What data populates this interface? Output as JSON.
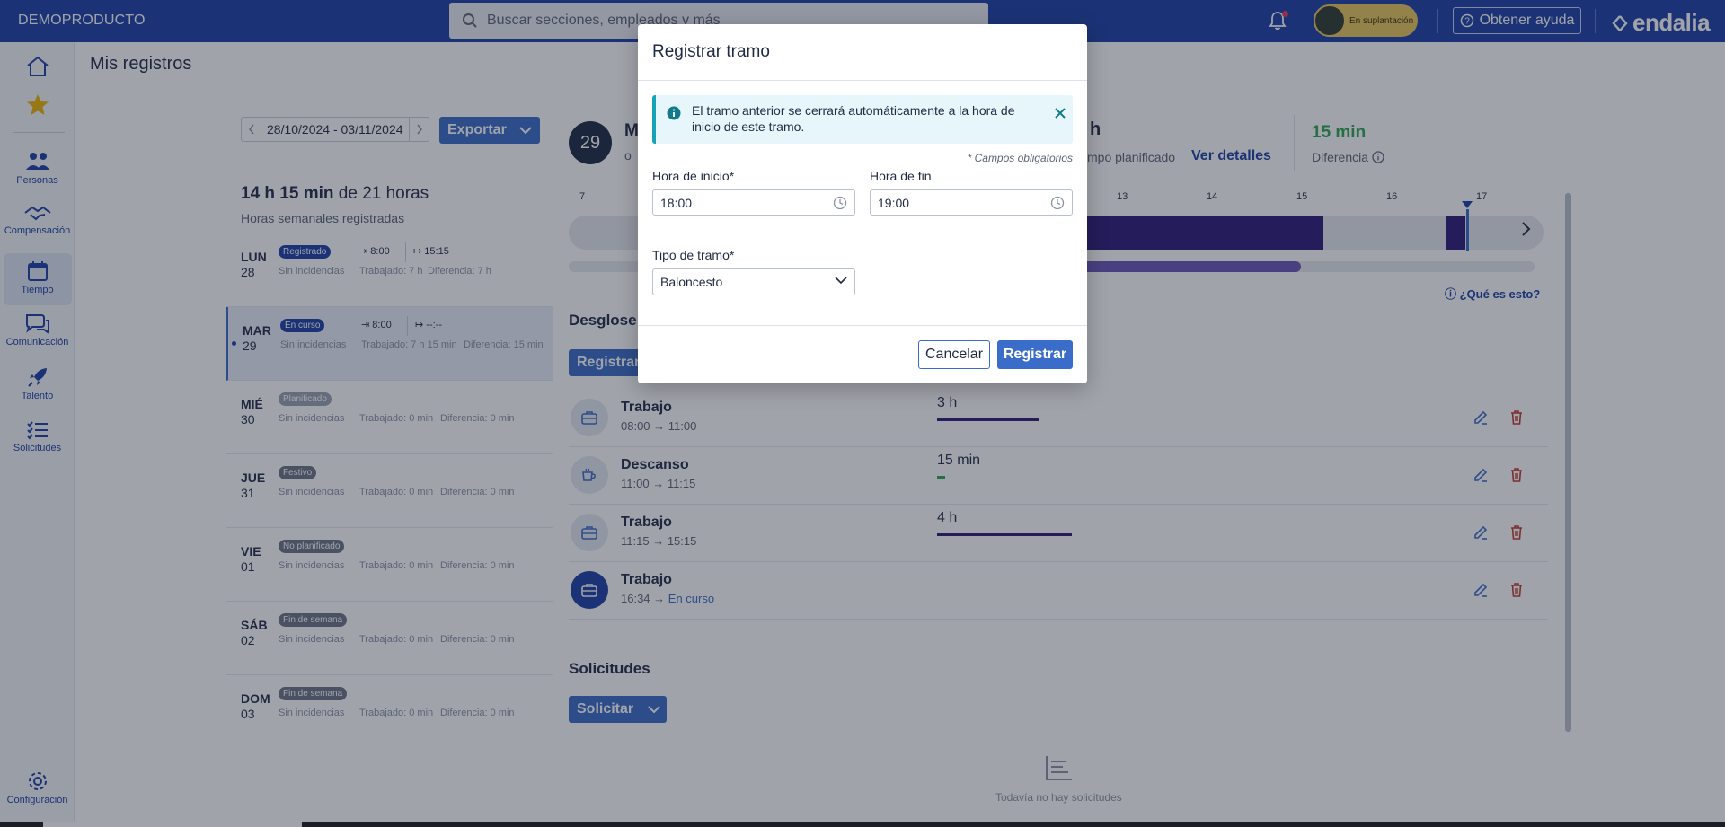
{
  "header": {
    "brand": "DEMOPRODUCTO",
    "search_placeholder": "Buscar secciones, empleados y más",
    "impersonation_label": "En suplantación",
    "help_label": "Obtener ayuda",
    "logo_text": "endalia"
  },
  "sidebar": {
    "items": [
      {
        "label": ""
      },
      {
        "label": ""
      },
      {
        "label": "Personas"
      },
      {
        "label": "Compensación"
      },
      {
        "label": "Tiempo"
      },
      {
        "label": "Comunicación"
      },
      {
        "label": "Talento"
      },
      {
        "label": "Solicitudes"
      },
      {
        "label": "Configuración"
      }
    ]
  },
  "page": {
    "title": "Mis registros",
    "date_range": "28/10/2024 - 03/11/2024",
    "export_label": "Exportar",
    "weekly_hours": "14 h 15 min",
    "weekly_of": "de 21 horas",
    "weekly_sub": "Horas semanales registradas"
  },
  "days": [
    {
      "name": "LUN",
      "num": "28",
      "badge": "Registrado",
      "badge_color": "#1b3fa6",
      "incidences": "Sin incidencias",
      "worked": "Trabajado: 7 h",
      "diff": "Diferencia: 7 h",
      "in": "8:00",
      "out": "15:15"
    },
    {
      "name": "MAR",
      "num": "29",
      "badge": "En curso",
      "badge_color": "#1b3fa6",
      "incidences": "Sin incidencias",
      "worked": "Trabajado: 7 h 15 min",
      "diff": "Diferencia: 15 min",
      "in": "8:00",
      "out": "--:--"
    },
    {
      "name": "MIÉ",
      "num": "30",
      "badge": "Planificado",
      "badge_color": "#9aa1b0",
      "incidences": "Sin incidencias",
      "worked": "Trabajado: 0 min",
      "diff": "Diferencia: 0 min"
    },
    {
      "name": "JUE",
      "num": "31",
      "badge": "Festivo",
      "badge_color": "#6b7385",
      "incidences": "Sin incidencias",
      "worked": "Trabajado: 0 min",
      "diff": "Diferencia: 0 min"
    },
    {
      "name": "VIE",
      "num": "01",
      "badge": "No planificado",
      "badge_color": "#6b7385",
      "incidences": "Sin incidencias",
      "worked": "Trabajado: 0 min",
      "diff": "Diferencia: 0 min"
    },
    {
      "name": "SÁB",
      "num": "02",
      "badge": "Fin de semana",
      "badge_color": "#6b7385",
      "incidences": "Sin incidencias",
      "worked": "Trabajado: 0 min",
      "diff": "Diferencia: 0 min"
    },
    {
      "name": "DOM",
      "num": "03",
      "badge": "Fin de semana",
      "badge_color": "#6b7385",
      "incidences": "Sin incidencias",
      "worked": "Trabajado: 0 min",
      "diff": "Diferencia: 0 min"
    }
  ],
  "detail": {
    "day_circle": "29",
    "peek_title": "M",
    "peek_sub": "o",
    "planned_frag": "h",
    "planned_label_frag": "mpo planificado",
    "details_link": "Ver detalles",
    "difference_value": "15 min",
    "difference_label": "Diferencia",
    "timeline_ticks": [
      "7",
      "13",
      "14",
      "15",
      "16",
      "17"
    ],
    "what_is_this": "¿Qué es esto?",
    "breakdown_title": "Desglose",
    "register_btn": "Registrar",
    "segments": [
      {
        "title": "Trabajo",
        "start": "08:00",
        "end": "11:00",
        "duration": "3 h",
        "bar": 0.375
      },
      {
        "title": "Descanso",
        "start": "11:00",
        "end": "11:15",
        "duration": "15 min",
        "bar": 0.03
      },
      {
        "title": "Trabajo",
        "start": "11:15",
        "end": "15:15",
        "duration": "4 h",
        "bar": 0.5
      },
      {
        "title": "Trabajo",
        "start": "16:34",
        "end": "En curso",
        "duration": "",
        "bar": 0
      }
    ],
    "requests_title": "Solicitudes",
    "request_btn": "Solicitar",
    "no_requests": "Todavía no hay solicitudes"
  },
  "modal": {
    "title": "Registrar tramo",
    "info_text": "El tramo anterior se cerrará automáticamente a la hora de inicio de este tramo.",
    "required_note": "* Campos obligatorios",
    "start_label": "Hora de inicio*",
    "start_value": "18:00",
    "end_label": "Hora de fin",
    "end_value": "19:00",
    "type_label": "Tipo de tramo*",
    "type_value": "Baloncesto",
    "cancel_label": "Cancelar",
    "register_label": "Registrar"
  },
  "colors": {
    "brand": "#1b3fa6",
    "accent": "#3a6cc9",
    "segment_purple": "#2c1878",
    "positive": "#2ea44f",
    "danger": "#c0392b"
  }
}
